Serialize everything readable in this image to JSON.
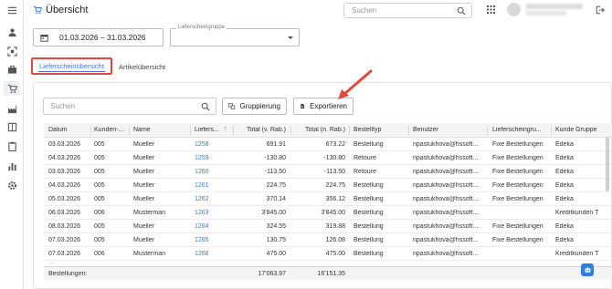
{
  "header": {
    "title": "Übersicht",
    "search_placeholder": "Suchen"
  },
  "filters": {
    "date_range": "01.03.2026 – 31.03.2026",
    "group_label": "Lieferscheingruppe",
    "group_value": ""
  },
  "tabs": [
    {
      "label": "Lieferscheinübersicht",
      "active": true
    },
    {
      "label": "Artikelübersicht",
      "active": false
    }
  ],
  "toolbar": {
    "search_placeholder": "Suchen",
    "group_button": "Gruppierung",
    "export_button": "Exportieren"
  },
  "table": {
    "columns": [
      "Datum",
      "Kunden-...",
      "Name",
      "Liefers...",
      "Total (v. Rab.)",
      "Total (n. Rab.)",
      "Bestelltyp",
      "Benutzer",
      "Lieferscheingru...",
      "Kunde Gruppe"
    ],
    "rows": [
      [
        "03.03.2026",
        "005",
        "Mueller",
        "1258",
        "691.91",
        "673.22",
        "Bestellung",
        "npastukhova@hssoft...",
        "Fixe Bestellungen",
        "Edeka"
      ],
      [
        "04.03.2026",
        "005",
        "Mueller",
        "1259",
        "-130.80",
        "-130.80",
        "Retoure",
        "npastukhova@hssoft...",
        "Fixe Bestellungen",
        "Edeka"
      ],
      [
        "03.03.2026",
        "005",
        "Mueller",
        "1260",
        "-113.50",
        "-113.50",
        "Retoure",
        "npastukhova@hssoft...",
        "Fixe Bestellungen",
        "Edeka"
      ],
      [
        "04.03.2026",
        "005",
        "Mueller",
        "1261",
        "224.75",
        "224.75",
        "Bestellung",
        "npastukhova@hssoft...",
        "Fixe Bestellungen",
        "Edeka"
      ],
      [
        "05.03.2026",
        "005",
        "Mueller",
        "1262",
        "370.14",
        "356.12",
        "Bestellung",
        "npastukhova@hssoft...",
        "Fixe Bestellungen",
        "Edeka"
      ],
      [
        "06.03.2026",
        "006",
        "Musterman",
        "1263",
        "3'845.00",
        "3'845.00",
        "Bestellung",
        "npastukhova@hssoft...",
        "",
        "Kreditkunden T"
      ],
      [
        "08.03.2026",
        "005",
        "Mueller",
        "1264",
        "324.55",
        "319.88",
        "Bestellung",
        "npastukhova@hssoft...",
        "Fixe Bestellungen",
        "Edeka"
      ],
      [
        "07.03.2026",
        "005",
        "Mueller",
        "1265",
        "130.75",
        "126.08",
        "Bestellung",
        "npastukhova@hssoft...",
        "Fixe Bestellungen",
        "Edeka"
      ],
      [
        "07.03.2026",
        "006",
        "Musterman",
        "1266",
        "475.00",
        "475.00",
        "Bestellung",
        "npastukhova@hssoft...",
        "",
        "Kreditkunden T"
      ]
    ],
    "footer": {
      "label": "Bestellungen: ",
      "total_before": "17'063.97",
      "total_after": "16'151.35"
    }
  },
  "accent_color": "#3c7ad6",
  "highlight_color": "#e04a3c"
}
